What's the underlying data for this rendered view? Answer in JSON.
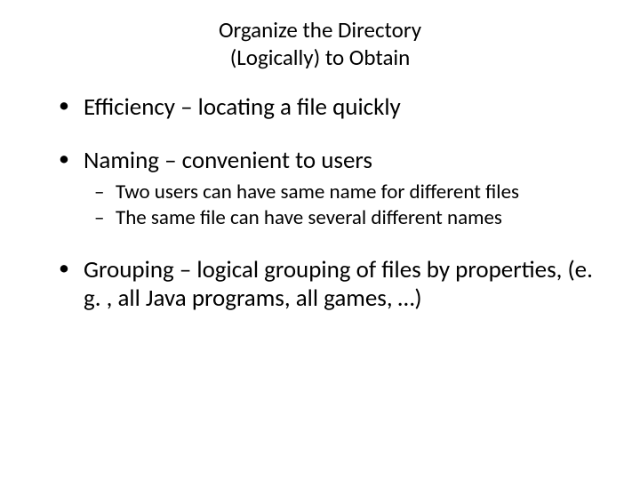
{
  "title_line1": "Organize the Directory",
  "title_line2": "(Logically) to Obtain",
  "bullets": {
    "b1": "Efficiency – locating a file quickly",
    "b2": "Naming – convenient to users",
    "b2_sub": {
      "s1": "Two users can have same name for different files",
      "s2": "The same file can have several different names"
    },
    "b3": "Grouping – logical grouping of files by properties, (e. g. , all Java programs, all games, …)"
  }
}
